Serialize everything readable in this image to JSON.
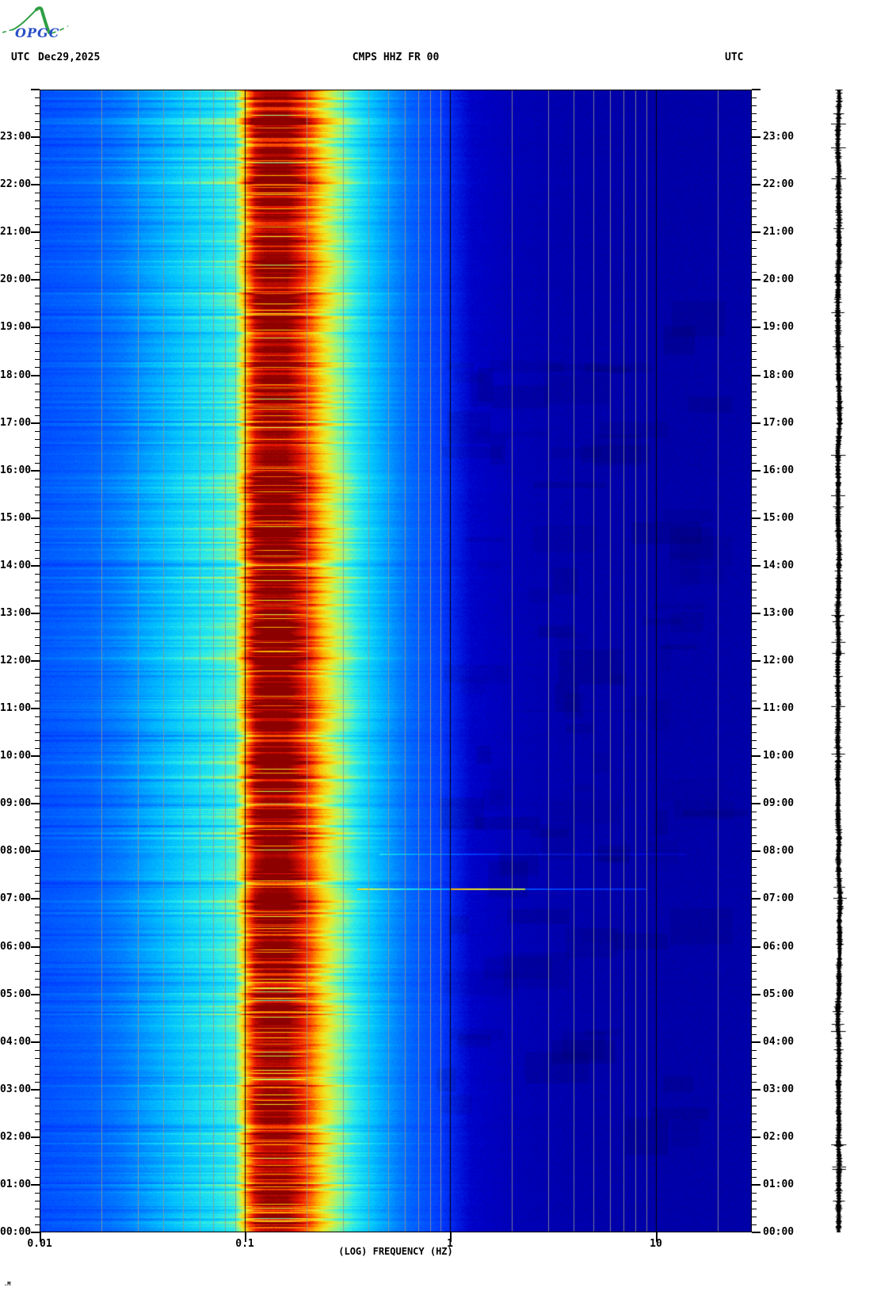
{
  "header": {
    "utc_left": "UTC",
    "date": "Dec29,2025",
    "title": "CMPS HHZ FR 00",
    "utc_right": "UTC"
  },
  "logo": {
    "text": "OPGC",
    "green": "#2F9E44",
    "blue": "#2B4FC7"
  },
  "corner_mark": ".M",
  "x_axis": {
    "title": "(LOG) FREQUENCY (HZ)",
    "scale": "log",
    "ticks": [
      {
        "hz": 0.01,
        "label": "0.01"
      },
      {
        "hz": 0.1,
        "label": "0.1"
      },
      {
        "hz": 1,
        "label": "1"
      },
      {
        "hz": 10,
        "label": "10"
      }
    ]
  },
  "y_axis": {
    "unit": "UTC",
    "hour_labels": [
      "00:00",
      "01:00",
      "02:00",
      "03:00",
      "04:00",
      "05:00",
      "06:00",
      "07:00",
      "08:00",
      "09:00",
      "10:00",
      "11:00",
      "12:00",
      "13:00",
      "14:00",
      "15:00",
      "16:00",
      "17:00",
      "18:00",
      "19:00",
      "20:00",
      "21:00",
      "22:00",
      "23:00"
    ],
    "minor_tick_minutes": 10
  },
  "chart_data": {
    "type": "heatmap",
    "subtype": "seismic spectrogram, 24h, time vertical (00:00 bottom - 24:00 top), log frequency horizontal",
    "title": "CMPS HHZ FR 00",
    "date": "Dec29,2025",
    "xlabel": "(LOG) FREQUENCY (HZ)",
    "x_range_hz": [
      0.01,
      29
    ],
    "x_tick_hz": [
      0.01,
      0.1,
      1,
      10
    ],
    "y_range_hours_utc": [
      0,
      24
    ],
    "gridlines_minor_hz": [
      0.02,
      0.03,
      0.04,
      0.05,
      0.06,
      0.07,
      0.08,
      0.09,
      0.2,
      0.3,
      0.4,
      0.5,
      0.6,
      0.7,
      0.8,
      0.9,
      2,
      3,
      4,
      5,
      6,
      7,
      8,
      9,
      20
    ],
    "gridlines_major_hz": [
      0.1,
      1,
      10
    ],
    "gridline_minor_color": "#96968C",
    "gridline_major_color": "#000000",
    "colormap_stops": [
      [
        0.0,
        0,
        0,
        130
      ],
      [
        0.1,
        0,
        0,
        200
      ],
      [
        0.2,
        0,
        60,
        255
      ],
      [
        0.3,
        0,
        120,
        255
      ],
      [
        0.4,
        0,
        190,
        255
      ],
      [
        0.5,
        40,
        235,
        235
      ],
      [
        0.58,
        150,
        245,
        130
      ],
      [
        0.66,
        235,
        235,
        40
      ],
      [
        0.74,
        255,
        180,
        0
      ],
      [
        0.82,
        255,
        90,
        0
      ],
      [
        0.9,
        230,
        20,
        0
      ],
      [
        1.0,
        140,
        0,
        0
      ]
    ],
    "spectral_profile_log10hz_intensity": [
      [
        -2.0,
        0.23
      ],
      [
        -1.75,
        0.26
      ],
      [
        -1.6,
        0.3
      ],
      [
        -1.45,
        0.36
      ],
      [
        -1.3,
        0.42
      ],
      [
        -1.15,
        0.47
      ],
      [
        -1.05,
        0.52
      ],
      [
        -1.0,
        0.72
      ],
      [
        -0.95,
        0.92
      ],
      [
        -0.9,
        0.98
      ],
      [
        -0.8,
        0.98
      ],
      [
        -0.74,
        0.9
      ],
      [
        -0.68,
        0.8
      ],
      [
        -0.62,
        0.68
      ],
      [
        -0.55,
        0.58
      ],
      [
        -0.45,
        0.47
      ],
      [
        -0.35,
        0.38
      ],
      [
        -0.2,
        0.27
      ],
      [
        -0.05,
        0.2
      ],
      [
        0.1,
        0.1
      ],
      [
        0.3,
        0.075
      ],
      [
        0.6,
        0.06
      ],
      [
        1.0,
        0.055
      ],
      [
        1.47,
        0.055
      ]
    ],
    "row_variation_weight_log10hz": [
      [
        -2.0,
        0.8
      ],
      [
        -1.7,
        0.95
      ],
      [
        -1.3,
        1.0
      ],
      [
        -0.8,
        0.95
      ],
      [
        -0.5,
        0.7
      ],
      [
        -0.2,
        0.45
      ],
      [
        0.1,
        0.3
      ],
      [
        1.47,
        0.18
      ]
    ],
    "notable_features": "strong dark-red microseism band ~0.11-0.19 Hz all day; cyan/yellow streaks 0.05-0.09 Hz; deep navy above ~1.3 Hz",
    "events": [
      {
        "time_utc": "07:12",
        "hz_from": 0.35,
        "hz_to": 9,
        "boost": 0.22,
        "rows": 2,
        "bright_hz_from": 1.0,
        "bright_hz_to": 2.3,
        "bright_boost": 0.4
      },
      {
        "time_utc": "07:56",
        "hz_from": 0.45,
        "hz_to": 14,
        "boost": 0.11,
        "rows": 2
      },
      {
        "time_utc": "10:57",
        "hz_from": 2,
        "hz_to": 15,
        "boost": -0.025,
        "rows": 1
      },
      {
        "time_utc": "02:25",
        "hz_from": 1.5,
        "hz_to": 18,
        "boost": -0.025,
        "rows": 1
      }
    ],
    "side_trace": "compressed 24h vertical seismogram wiggle trace (black) right of plot"
  }
}
